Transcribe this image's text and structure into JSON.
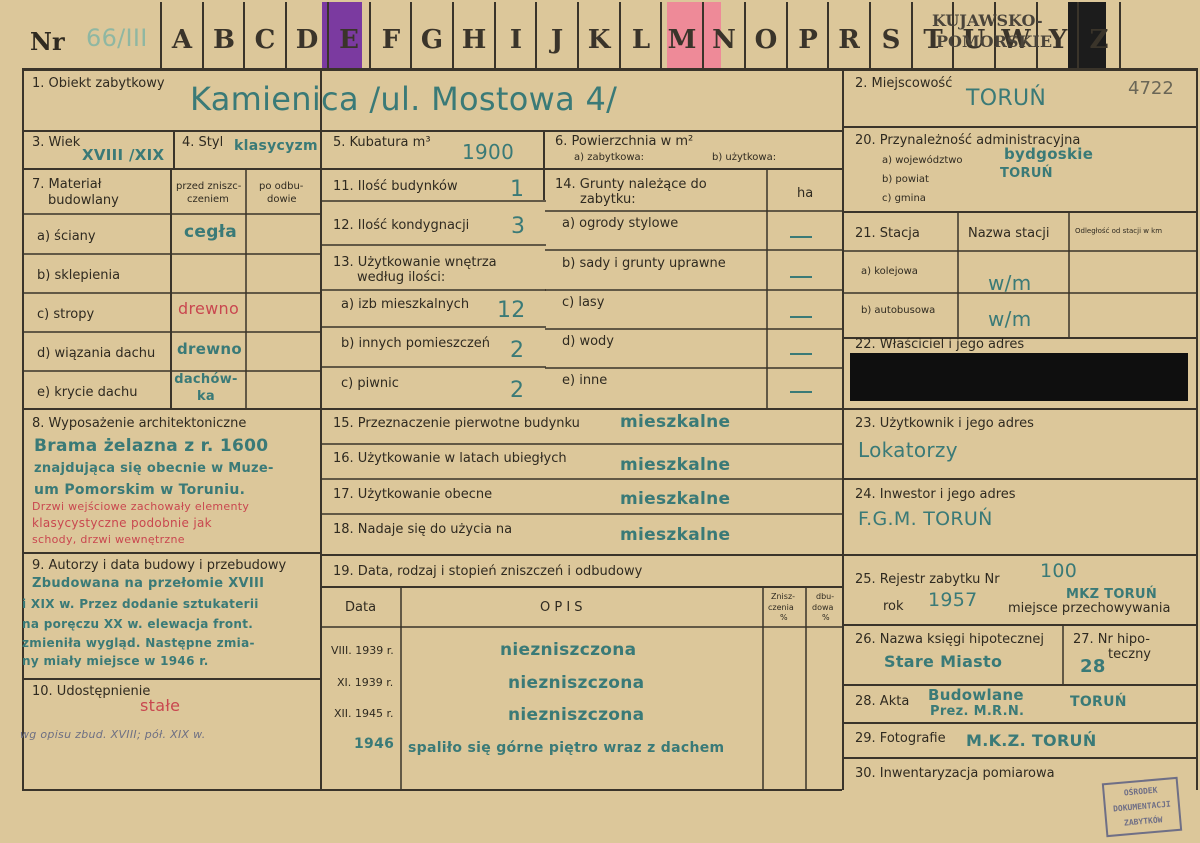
{
  "header": {
    "nr_label": "Nr",
    "nr_value": "66/III",
    "letters": [
      "A",
      "B",
      "C",
      "D",
      "E",
      "F",
      "G",
      "H",
      "I",
      "J",
      "K",
      "L",
      "M",
      "N",
      "O",
      "P",
      "R",
      "S",
      "T",
      "U",
      "W",
      "Y",
      "Z"
    ],
    "region_line1": "KUJAWSKO-",
    "region_line2": "POMORSKIE",
    "number_corner": "4722",
    "marker_colors": {
      "purple": "#7b3aa0",
      "pink": "#ee8a98",
      "black": "#1c1c1c"
    }
  },
  "fields": {
    "f1": {
      "label": "1. Obiekt zabytkowy",
      "value": "Kamienica /ul. Mostowa 4/"
    },
    "f2": {
      "label": "2. Miejscowość",
      "value": "TORUŃ"
    },
    "f3": {
      "label": "3. Wiek",
      "value": "XVIII /XIX"
    },
    "f4": {
      "label": "4. Styl",
      "value": "klasycyzm"
    },
    "f5": {
      "label": "5. Kubatura m³",
      "value": "1900"
    },
    "f6": {
      "label": "6. Powierzchnia w m²",
      "sub_a": "a) zabytkowa:",
      "sub_b": "b) użytkowa:"
    },
    "f20": {
      "label": "20. Przynależność administracyjna",
      "a": "a) województwo",
      "a_val": "bydgoskie",
      "b": "b) powiat",
      "b_val": "TORUŃ",
      "c": "c) gmina"
    },
    "f7": {
      "label_line1": "7. Materiał",
      "label_line2": "budowlany",
      "col1_line1": "przed zniszc-",
      "col1_line2": "czeniem",
      "col2_line1": "po odbu-",
      "col2_line2": "dowie",
      "rows": [
        {
          "label": "a) ściany",
          "value": "cegła",
          "red": false
        },
        {
          "label": "b) sklepienia",
          "value": "",
          "red": false
        },
        {
          "label": "c) stropy",
          "value": "drewno",
          "red": true
        },
        {
          "label": "d) wiązania dachu",
          "value": "drewno",
          "red": false
        },
        {
          "label": "e) krycie dachu",
          "value": "dachów-ka",
          "red": false
        }
      ]
    },
    "f11": {
      "label": "11. Ilość budynków",
      "value": "1"
    },
    "f12": {
      "label": "12. Ilość kondygnacji",
      "value": "3"
    },
    "f13": {
      "label_line1": "13. Użytkowanie wnętrza",
      "label_line2": "według ilości:",
      "rows": [
        {
          "label": "a) izb mieszkalnych",
          "value": "12"
        },
        {
          "label": "b) innych pomieszczeń",
          "value": "2"
        },
        {
          "label": "c) piwnic",
          "value": "2"
        }
      ]
    },
    "f14": {
      "label_line1": "14. Grunty należące do",
      "label_line2": "zabytku:",
      "unit": "ha",
      "rows": [
        "a) ogrody stylowe",
        "b) sady i grunty uprawne",
        "c) lasy",
        "d) wody",
        "e) inne"
      ]
    },
    "f21": {
      "label": "21. Stacja",
      "col_name": "Nazwa stacji",
      "col_dist": "Odległość od stacji w km",
      "rows": [
        {
          "label": "a) kolejowa",
          "value": "w/m"
        },
        {
          "label": "b) autobusowa",
          "value": "w/m"
        }
      ]
    },
    "f22": {
      "label": "22. Właściciel i jego adres"
    },
    "f8": {
      "label": "8. Wyposażenie architektoniczne",
      "text_green": [
        "Brama żelazna z r. 1600",
        "znajdująca się obecnie w Muze-",
        "um Pomorskim w Toruniu."
      ],
      "text_red": [
        "Drzwi wejściowe zachowały elementy",
        "klasycystyczne podobnie jak",
        "schody, drzwi wewnętrzne"
      ]
    },
    "f15": {
      "label": "15. Przeznaczenie pierwotne budynku",
      "value": "mieszkalne"
    },
    "f16": {
      "label": "16. Użytkowanie w latach ubiegłych",
      "value": "mieszkalne"
    },
    "f17": {
      "label": "17. Użytkowanie obecne",
      "value": "mieszkalne"
    },
    "f18": {
      "label": "18. Nadaje się do użycia na",
      "value": "mieszkalne"
    },
    "f23": {
      "label": "23. Użytkownik i jego adres",
      "value": "Lokatorzy"
    },
    "f24": {
      "label": "24. Inwestor i jego adres",
      "value": "F.G.M. TORUŃ"
    },
    "f9": {
      "label": "9. Autorzy i data budowy i przebudowy",
      "text": [
        "Zbudowana na przełomie XVIII",
        "i XIX w. Przez dodanie sztukaterii",
        "na poręczu XX w. elewacja front.",
        "zmieniła wygląd. Następne zmia-",
        "ny miały miejsce w 1946 r."
      ]
    },
    "f10": {
      "label": "10. Udostępnienie",
      "value": "stałe",
      "note": "wg opisu zbud. XVIII; pół. XIX w."
    },
    "f19": {
      "label": "19. Data, rodzaj i stopień zniszczeń i odbudowy",
      "col_date": "Data",
      "col_opis": "O P I S",
      "col_z_line1": "Znisz-",
      "col_z_line2": "czenia",
      "col_z_line3": "%",
      "col_o_line1": "dbu-",
      "col_o_line2": "dowa",
      "col_o_line3": "%",
      "rows": [
        {
          "date": "VIII. 1939 r.",
          "desc": "niezniszczona"
        },
        {
          "date": "XI. 1939 r.",
          "desc": "niezniszczona"
        },
        {
          "date": "XII. 1945 r.",
          "desc": "niezniszczona"
        },
        {
          "date": "1946",
          "desc": "spaliło się górne piętro wraz z dachem"
        }
      ]
    },
    "f25": {
      "label": "25. Rejestr zabytku Nr",
      "nr": "100",
      "rok_label": "rok",
      "rok": "1957",
      "place_label": "miejsce przechowywania",
      "place": "MKZ TORUŃ"
    },
    "f26": {
      "label": "26. Nazwa księgi hipotecznej",
      "value": "Stare Miasto"
    },
    "f27": {
      "label_line1": "27. Nr hipo-",
      "label_line2": "teczny",
      "value": "28"
    },
    "f28": {
      "label": "28. Akta",
      "value_line1": "Budowlane",
      "value_line2": "Prez. M.R.N.",
      "value_right": "TORUŃ"
    },
    "f29": {
      "label": "29. Fotografie",
      "value": "M.K.Z. TORUŃ"
    },
    "f30": {
      "label": "30. Inwentaryzacja pomiarowa"
    }
  },
  "stamp": {
    "line1": "OŚRODEK",
    "line2": "DOKUMENTACJI",
    "line3": "ZABYTKÓW"
  }
}
